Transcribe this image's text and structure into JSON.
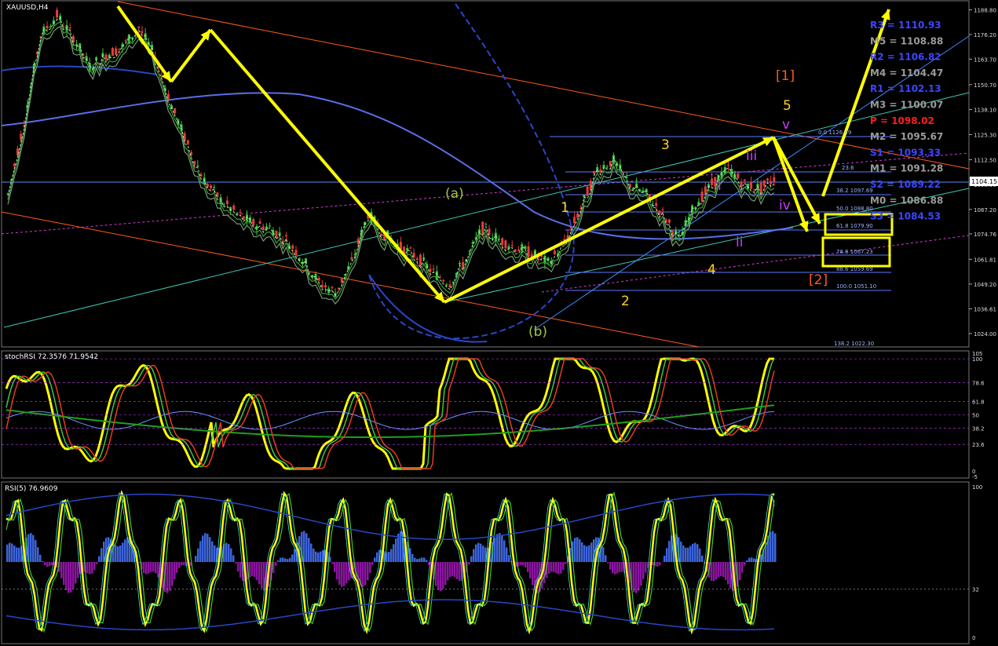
{
  "main": {
    "symbol": "XAUUSD,H4",
    "price_ticks": [
      "1188.80",
      "1176.20",
      "1163.70",
      "1150.70",
      "1138.10",
      "1125.30",
      "1112.50",
      "1099.90",
      "1087.20",
      "1074.76",
      "1061.81",
      "1049.20",
      "1036.61",
      "1024.00"
    ],
    "current_price": "1104.15",
    "pivots": [
      {
        "label": "R3 = 1110.93",
        "color": "#3c46ff"
      },
      {
        "label": "M5 = 1108.88",
        "color": "#9a9a9a"
      },
      {
        "label": "R2 = 1106.82",
        "color": "#3c46ff"
      },
      {
        "label": "M4 = 1104.47",
        "color": "#9a9a9a"
      },
      {
        "label": "R1 = 1102.13",
        "color": "#3c46ff"
      },
      {
        "label": "M3 = 1100.07",
        "color": "#9a9a9a"
      },
      {
        "label": "P = 1098.02",
        "color": "#ff1e1e"
      },
      {
        "label": "M2 = 1095.67",
        "color": "#9a9a9a"
      },
      {
        "label": "S1 = 1093.33",
        "color": "#3c46ff"
      },
      {
        "label": "M1 = 1091.28",
        "color": "#9a9a9a"
      },
      {
        "label": "S2 = 1089.22",
        "color": "#3c46ff"
      },
      {
        "label": "M0 = 1086.88",
        "color": "#9a9a9a"
      },
      {
        "label": "S3 = 1084.53",
        "color": "#3c46ff"
      }
    ],
    "fib_levels": [
      "0.0 1126.49",
      "23.6",
      "38.2 1097.69",
      "50.0 1088.80",
      "61.8 1079.90",
      "78.6 1067.23",
      "88.6 1059.69",
      "100.0 1051.10",
      "138.2 1022.30"
    ],
    "wave_labels": {
      "degree1": "[1]",
      "degree2": "[2]",
      "a": "(a)",
      "b": "(b)",
      "w1": "1",
      "w2": "2",
      "w3": "3",
      "w4": "4",
      "w5": "5",
      "sub_i": "i",
      "sub_ii": "ii",
      "sub_iii": "iii",
      "sub_iv": "iv",
      "sub_v": "v"
    }
  },
  "stoch": {
    "label": "stochRSI 72.3576 71.9542",
    "ticks": [
      "105",
      "100",
      "78.6",
      "61.8",
      "50",
      "38.2",
      "23.6",
      "0",
      "-5"
    ]
  },
  "rsi": {
    "label": "RSI(5) 76.9609",
    "ticks": [
      "100",
      "32",
      "0"
    ]
  },
  "colors": {
    "path_arrow": "#ffff00",
    "wave_number": "#ffd21e",
    "subwave": "#c83cff",
    "degree": "#ff5a1e",
    "abc": "#a0c83c"
  },
  "chart_data": [
    {
      "type": "line",
      "title": "XAUUSD,H4",
      "ylim": [
        1018,
        1193
      ],
      "series": [
        {
          "values": [
            1095,
            1132,
            1176,
            1186,
            1175,
            1160,
            1166,
            1170,
            1180,
            1165,
            1140,
            1120,
            1102,
            1092,
            1085,
            1080,
            1078,
            1072,
            1062,
            1050,
            1045,
            1060,
            1085,
            1075,
            1068,
            1063,
            1055,
            1050,
            1062,
            1078,
            1072,
            1068,
            1065,
            1060,
            1070,
            1088,
            1108,
            1112,
            1100,
            1095,
            1085,
            1072,
            1090,
            1100,
            1108,
            1100,
            1098,
            1104
          ]
        }
      ],
      "wave_path": [
        [
          1188,
          1
        ],
        [
          1156,
          2
        ],
        [
          1180,
          3
        ],
        [
          1043,
          4
        ],
        [
          1128,
          5
        ],
        [
          1077,
          6
        ],
        [
          1071,
          7
        ],
        [
          1099,
          8
        ],
        [
          1192,
          9
        ]
      ]
    },
    {
      "type": "line",
      "title": "stochRSI",
      "ylim": [
        -5,
        105
      ]
    },
    {
      "type": "line",
      "title": "RSI(5)",
      "ylim": [
        0,
        100
      ]
    }
  ]
}
